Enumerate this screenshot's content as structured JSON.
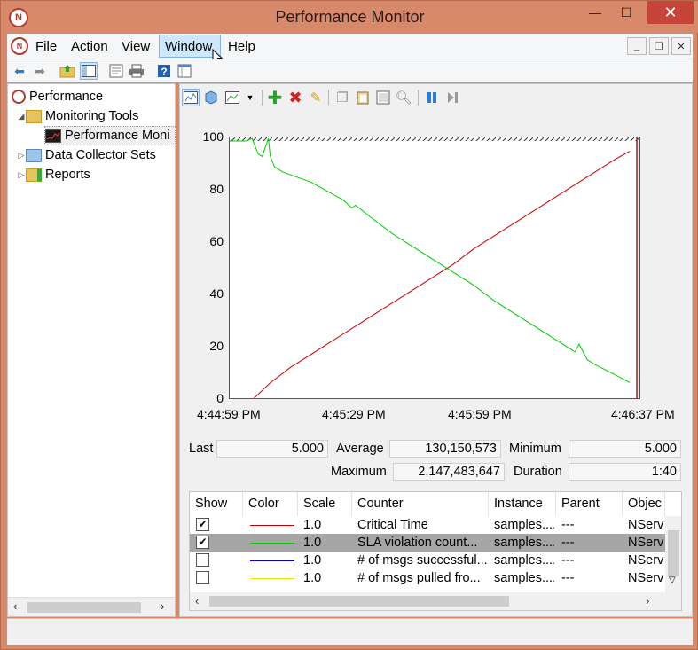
{
  "window": {
    "title": "Performance Monitor",
    "minimize_glyph": "—",
    "maximize_glyph": "☐",
    "close_glyph": "✕"
  },
  "menu": {
    "items": [
      "File",
      "Action",
      "View",
      "Window",
      "Help"
    ],
    "active": "Window",
    "mdi_minimize": "_",
    "mdi_restore": "❐",
    "mdi_close": "✕"
  },
  "tree": {
    "items": [
      {
        "label": "Performance",
        "icon": "performance-icon"
      },
      {
        "label": "Monitoring Tools",
        "icon": "folder-icon"
      },
      {
        "label": "Performance Moni",
        "icon": "performance-monitor-icon"
      },
      {
        "label": "Data Collector Sets",
        "icon": "data-collector-icon"
      },
      {
        "label": "Reports",
        "icon": "reports-icon"
      }
    ]
  },
  "chart_data": {
    "type": "line",
    "y_ticks": [
      "100",
      "80",
      "60",
      "40",
      "20",
      "0"
    ],
    "ylim": [
      0,
      100
    ],
    "x_ticks": [
      "4:44:59 PM",
      "4:45:29 PM",
      "4:45:59 PM",
      "4:46:37 PM"
    ],
    "series": [
      {
        "name": "Critical Time",
        "color": "#cc0000",
        "x": [
          0.06,
          0.1,
          0.15,
          0.2,
          0.25,
          0.3,
          0.35,
          0.4,
          0.45,
          0.5,
          0.55,
          0.6,
          0.65,
          0.7,
          0.75,
          0.8,
          0.85,
          0.9,
          0.95,
          0.985
        ],
        "y": [
          0,
          6,
          12,
          17,
          22,
          27,
          32,
          37,
          42,
          47,
          52,
          58,
          63,
          68,
          73,
          78,
          83,
          88,
          93,
          96
        ]
      },
      {
        "name": "SLA violation count...",
        "color": "#00cc00",
        "x": [
          0.0,
          0.04,
          0.055,
          0.07,
          0.08,
          0.095,
          0.1,
          0.11,
          0.13,
          0.2,
          0.28,
          0.3,
          0.31,
          0.35,
          0.4,
          0.45,
          0.5,
          0.55,
          0.6,
          0.65,
          0.7,
          0.75,
          0.8,
          0.85,
          0.86,
          0.88,
          0.9,
          0.95,
          0.985
        ],
        "y": [
          100,
          100,
          101,
          95,
          94,
          101,
          94,
          90,
          88,
          84,
          77,
          74,
          75,
          70,
          64,
          59,
          54,
          49,
          44,
          38,
          33,
          28,
          23,
          18,
          21,
          15,
          13,
          9,
          6
        ]
      }
    ]
  },
  "stats": {
    "last_label": "Last",
    "last_value": "5.000",
    "average_label": "Average",
    "average_value": "130,150,573",
    "minimum_label": "Minimum",
    "minimum_value": "5.000",
    "maximum_label": "Maximum",
    "maximum_value": "2,147,483,647",
    "duration_label": "Duration",
    "duration_value": "1:40"
  },
  "table": {
    "headers": [
      "Show",
      "Color",
      "Scale",
      "Counter",
      "Instance",
      "Parent",
      "Objec"
    ],
    "rows": [
      {
        "checked": true,
        "color": "#cc0000",
        "scale": "1.0",
        "counter": "Critical Time",
        "instance": "samples....",
        "parent": "---",
        "object": "NServ"
      },
      {
        "checked": true,
        "color": "#00cc00",
        "scale": "1.0",
        "counter": "SLA violation count...",
        "instance": "samples....",
        "parent": "---",
        "object": "NServ"
      },
      {
        "checked": false,
        "color": "#0000cc",
        "scale": "1.0",
        "counter": "# of msgs successful...",
        "instance": "samples....",
        "parent": "---",
        "object": "NServ"
      },
      {
        "checked": false,
        "color": "#e8e800",
        "scale": "1.0",
        "counter": "# of msgs pulled fro...",
        "instance": "samples....",
        "parent": "---",
        "object": "NServ"
      }
    ],
    "selected_row": 1
  }
}
